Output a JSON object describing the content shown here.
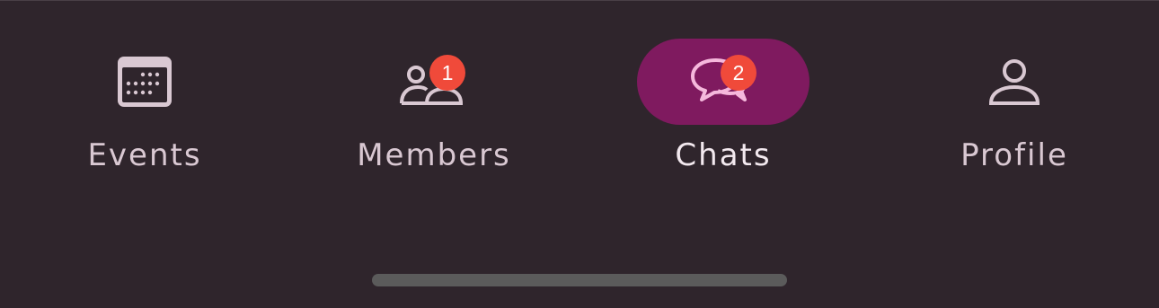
{
  "colors": {
    "background": "#2f252c",
    "icon": "#d9c8d2",
    "selected_icon": "#f5b8dc",
    "selected_pill": "#7f1a5f",
    "badge": "#f04a3a",
    "home_indicator": "#5b5b5b"
  },
  "tabs": [
    {
      "label": "Events",
      "icon": "calendar-icon",
      "selected": false,
      "badge": ""
    },
    {
      "label": "Members",
      "icon": "people-icon",
      "selected": false,
      "badge": "1"
    },
    {
      "label": "Chats",
      "icon": "chat-bubbles-icon",
      "selected": true,
      "badge": "2"
    },
    {
      "label": "Profile",
      "icon": "person-icon",
      "selected": false,
      "badge": ""
    }
  ]
}
